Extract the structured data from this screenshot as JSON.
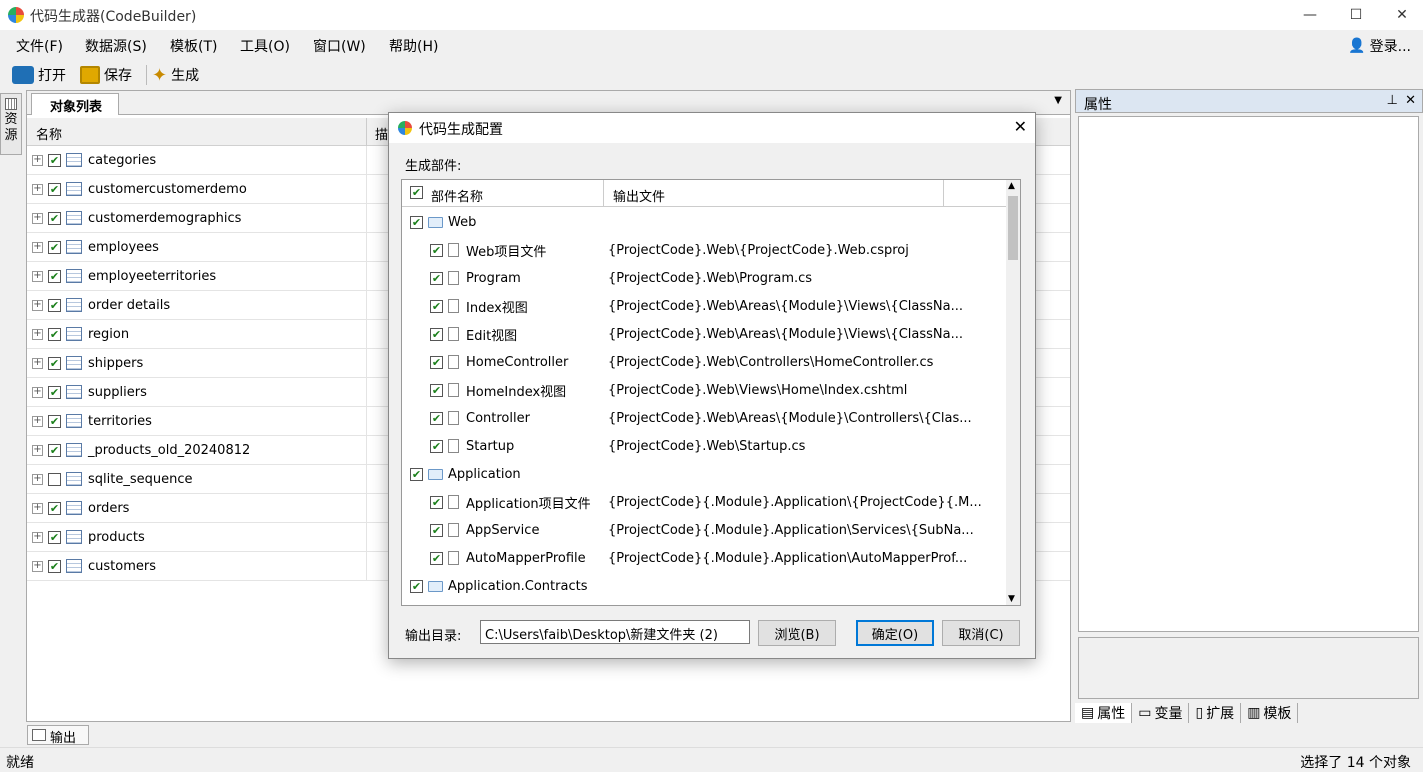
{
  "window": {
    "title": "代码生成器(CodeBuilder)",
    "minimize": "—",
    "maximize": "☐",
    "close": "✕"
  },
  "menu": [
    "文件(F)",
    "数据源(S)",
    "模板(T)",
    "工具(O)",
    "窗口(W)",
    "帮助(H)"
  ],
  "login": "登录...",
  "toolbar": {
    "open": "打开",
    "save": "保存",
    "generate": "生成"
  },
  "sidebar_tab": "资源",
  "object_panel": {
    "tab": "对象列表",
    "col_name": "名称",
    "col_desc": "描"
  },
  "tables": [
    {
      "name": "categories",
      "checked": true
    },
    {
      "name": "customercustomerdemo",
      "checked": true
    },
    {
      "name": "customerdemographics",
      "checked": true
    },
    {
      "name": "employees",
      "checked": true
    },
    {
      "name": "employeeterritories",
      "checked": true
    },
    {
      "name": "order details",
      "checked": true
    },
    {
      "name": "region",
      "checked": true
    },
    {
      "name": "shippers",
      "checked": true
    },
    {
      "name": "suppliers",
      "checked": true
    },
    {
      "name": "territories",
      "checked": true
    },
    {
      "name": "_products_old_20240812",
      "checked": true
    },
    {
      "name": "sqlite_sequence",
      "checked": false
    },
    {
      "name": "orders",
      "checked": true
    },
    {
      "name": "products",
      "checked": true
    },
    {
      "name": "customers",
      "checked": true
    }
  ],
  "properties": {
    "title": "属性",
    "pin": "⊥",
    "close": "✕"
  },
  "bottom_tabs": [
    "属性",
    "变量",
    "扩展",
    "模板"
  ],
  "output_tab": "输出",
  "status": {
    "left": "就绪",
    "right": "选择了 14 个对象"
  },
  "dialog": {
    "title": "代码生成配置",
    "parts_label": "生成部件:",
    "col_part": "部件名称",
    "col_output": "输出文件",
    "items": [
      {
        "name": "Web",
        "level": 0,
        "type": "folder",
        "output": ""
      },
      {
        "name": "Web项目文件",
        "level": 1,
        "type": "file",
        "output": "{ProjectCode}.Web\\{ProjectCode}.Web.csproj"
      },
      {
        "name": "Program",
        "level": 1,
        "type": "file",
        "output": "{ProjectCode}.Web\\Program.cs"
      },
      {
        "name": "Index视图",
        "level": 1,
        "type": "file",
        "output": "{ProjectCode}.Web\\Areas\\{Module}\\Views\\{ClassNa..."
      },
      {
        "name": "Edit视图",
        "level": 1,
        "type": "file",
        "output": "{ProjectCode}.Web\\Areas\\{Module}\\Views\\{ClassNa..."
      },
      {
        "name": "HomeController",
        "level": 1,
        "type": "file",
        "output": "{ProjectCode}.Web\\Controllers\\HomeController.cs"
      },
      {
        "name": "HomeIndex视图",
        "level": 1,
        "type": "file",
        "output": "{ProjectCode}.Web\\Views\\Home\\Index.cshtml"
      },
      {
        "name": "Controller",
        "level": 1,
        "type": "file",
        "output": "{ProjectCode}.Web\\Areas\\{Module}\\Controllers\\{Clas..."
      },
      {
        "name": "Startup",
        "level": 1,
        "type": "file",
        "output": "{ProjectCode}.Web\\Startup.cs"
      },
      {
        "name": "Application",
        "level": 0,
        "type": "folder",
        "output": ""
      },
      {
        "name": "Application项目文件",
        "level": 1,
        "type": "file",
        "output": "{ProjectCode}{.Module}.Application\\{ProjectCode}{.M..."
      },
      {
        "name": "AppService",
        "level": 1,
        "type": "file",
        "output": "{ProjectCode}{.Module}.Application\\Services\\{SubNa..."
      },
      {
        "name": "AutoMapperProfile",
        "level": 1,
        "type": "file",
        "output": "{ProjectCode}{.Module}.Application\\AutoMapperProf..."
      },
      {
        "name": "Application.Contracts",
        "level": 0,
        "type": "folder",
        "output": ""
      }
    ],
    "outdir_label": "输出目录:",
    "outdir_value": "C:\\Users\\faib\\Desktop\\新建文件夹 (2)",
    "browse": "浏览(B)",
    "ok": "确定(O)",
    "cancel": "取消(C)"
  }
}
